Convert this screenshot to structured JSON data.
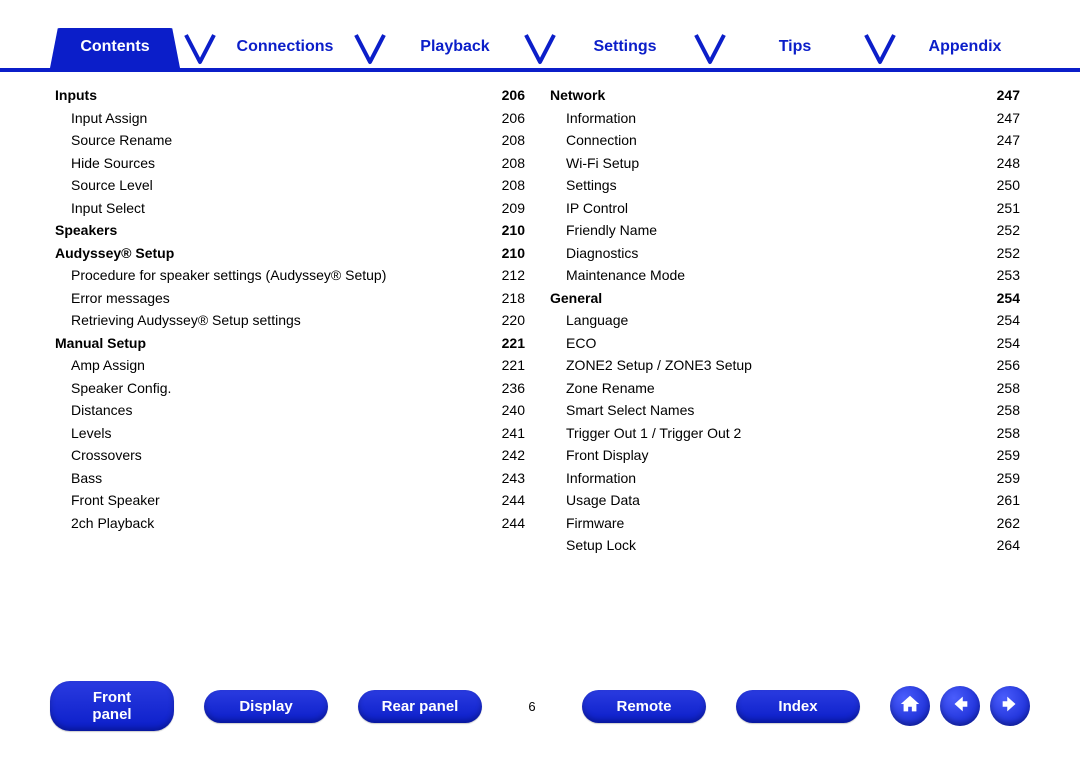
{
  "topnav": {
    "tabs": [
      {
        "label": "Contents",
        "active": true
      },
      {
        "label": "Connections",
        "active": false
      },
      {
        "label": "Playback",
        "active": false
      },
      {
        "label": "Settings",
        "active": false
      },
      {
        "label": "Tips",
        "active": false
      },
      {
        "label": "Appendix",
        "active": false
      }
    ]
  },
  "left_column": [
    {
      "type": "section",
      "label": "Inputs",
      "page": "206"
    },
    {
      "type": "item",
      "label": "Input Assign",
      "page": "206"
    },
    {
      "type": "item",
      "label": "Source Rename",
      "page": "208"
    },
    {
      "type": "item",
      "label": "Hide Sources",
      "page": "208"
    },
    {
      "type": "item",
      "label": "Source Level",
      "page": "208"
    },
    {
      "type": "item",
      "label": "Input Select",
      "page": "209"
    },
    {
      "type": "section",
      "label": "Speakers",
      "page": "210"
    },
    {
      "type": "section",
      "label": "Audyssey® Setup",
      "page": "210"
    },
    {
      "type": "item",
      "label": "Procedure for speaker settings (Audyssey® Setup)",
      "page": "212"
    },
    {
      "type": "item",
      "label": "Error messages",
      "page": "218"
    },
    {
      "type": "item",
      "label": "Retrieving Audyssey® Setup settings",
      "page": "220"
    },
    {
      "type": "section",
      "label": "Manual Setup",
      "page": "221"
    },
    {
      "type": "item",
      "label": "Amp Assign",
      "page": "221"
    },
    {
      "type": "item",
      "label": "Speaker Config.",
      "page": "236"
    },
    {
      "type": "item",
      "label": "Distances",
      "page": "240"
    },
    {
      "type": "item",
      "label": "Levels",
      "page": "241"
    },
    {
      "type": "item",
      "label": "Crossovers",
      "page": "242"
    },
    {
      "type": "item",
      "label": "Bass",
      "page": "243"
    },
    {
      "type": "item",
      "label": "Front Speaker",
      "page": "244"
    },
    {
      "type": "item",
      "label": "2ch Playback",
      "page": "244"
    }
  ],
  "right_column": [
    {
      "type": "section",
      "label": "Network",
      "page": "247"
    },
    {
      "type": "item",
      "label": "Information",
      "page": "247"
    },
    {
      "type": "item",
      "label": "Connection",
      "page": "247"
    },
    {
      "type": "item",
      "label": "Wi-Fi Setup",
      "page": "248"
    },
    {
      "type": "item",
      "label": "Settings",
      "page": "250"
    },
    {
      "type": "item",
      "label": "IP Control",
      "page": "251"
    },
    {
      "type": "item",
      "label": "Friendly Name",
      "page": "252"
    },
    {
      "type": "item",
      "label": "Diagnostics",
      "page": "252"
    },
    {
      "type": "item",
      "label": "Maintenance Mode",
      "page": "253"
    },
    {
      "type": "section",
      "label": "General",
      "page": "254"
    },
    {
      "type": "item",
      "label": "Language",
      "page": "254"
    },
    {
      "type": "item",
      "label": "ECO",
      "page": "254"
    },
    {
      "type": "item",
      "label": "ZONE2 Setup / ZONE3 Setup",
      "page": "256"
    },
    {
      "type": "item",
      "label": "Zone Rename",
      "page": "258"
    },
    {
      "type": "item",
      "label": "Smart Select Names",
      "page": "258"
    },
    {
      "type": "item",
      "label": "Trigger Out 1 / Trigger Out 2",
      "page": "258"
    },
    {
      "type": "item",
      "label": "Front Display",
      "page": "259"
    },
    {
      "type": "item",
      "label": "Information",
      "page": "259"
    },
    {
      "type": "item",
      "label": "Usage Data",
      "page": "261"
    },
    {
      "type": "item",
      "label": "Firmware",
      "page": "262"
    },
    {
      "type": "item",
      "label": "Setup Lock",
      "page": "264"
    }
  ],
  "footer": {
    "links": [
      {
        "label": "Front panel"
      },
      {
        "label": "Display"
      },
      {
        "label": "Rear panel"
      }
    ],
    "page_number": "6",
    "links2": [
      {
        "label": "Remote"
      },
      {
        "label": "Index"
      }
    ]
  }
}
